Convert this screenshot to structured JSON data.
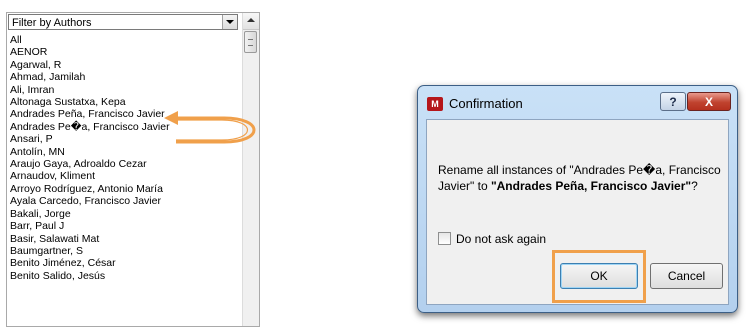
{
  "author_filter": {
    "select_label": "Filter by Authors",
    "items": [
      "All",
      "AENOR",
      "Agarwal, R",
      "Ahmad, Jamilah",
      "Ali, Imran",
      "Altonaga Sustatxa, Kepa",
      "Andrades Peña, Francisco Javier",
      "Andrades Pe�a, Francisco Javier",
      "Ansari, P",
      "Antolín, MN",
      "Araujo Gaya, Adroaldo Cezar",
      "Arnaudov, Kliment",
      "Arroyo Rodríguez, Antonio María",
      "Ayala Carcedo, Francisco Javier",
      "Bakali, Jorge",
      "Barr, Paul J",
      "Basir, Salawati Mat",
      "Baumgartner, S",
      "Benito Jiménez, César",
      "Benito Salido, Jesús"
    ]
  },
  "dialog": {
    "title": "Confirmation",
    "app_icon_letter": "M",
    "help_label": "?",
    "close_label": "X",
    "message_prefix": "Rename all instances of \"Andrades Pe�a, Francisco Javier\" to ",
    "message_target": "\"Andrades Peña, Francisco Javier\"",
    "message_suffix": "?",
    "checkbox_label": "Do not ask again",
    "ok_label": "OK",
    "cancel_label": "Cancel"
  },
  "colors": {
    "highlight": "#f0a04b",
    "dialog_frame": "#c9e1f7",
    "close_button": "#c0432f",
    "app_icon": "#b5161b"
  }
}
